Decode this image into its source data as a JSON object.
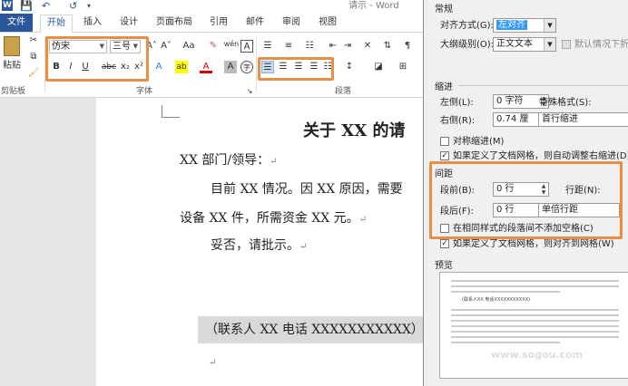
{
  "titlebar": {
    "quick_access": [
      "W",
      "💾",
      "↶",
      "↺"
    ],
    "title": "请示 - Word"
  },
  "tabs": [
    "文件",
    "开始",
    "插入",
    "设计",
    "页面布局",
    "引用",
    "邮件",
    "审阅",
    "视图"
  ],
  "ribbon": {
    "paste_label": "粘贴",
    "clipboard_label": "剪贴板",
    "font": {
      "name": "仿宋",
      "size": "三号",
      "label": "字体",
      "bold": "B",
      "italic": "I",
      "underline": "U",
      "strike": "abc",
      "sub": "x₂",
      "sup": "x²",
      "grow": "A˄",
      "shrink": "A˅",
      "case": "Aa",
      "clear": "✎",
      "pinyin": "wén",
      "border": "A",
      "effects": "A",
      "highlight": "ab",
      "color": "A",
      "shade": "A",
      "circle": "字"
    },
    "paragraph_label": "段落"
  },
  "document": {
    "title": "关于 XX 的请",
    "lines": [
      "XX 部门/领导：",
      "目前 XX 情况。因 XX 原因，需要",
      "设备 XX 件，所需资金 XX 元。",
      "妥否，请批示。"
    ],
    "contact": "（联系人 XX  电话 XXXXXXXXXXX）",
    "para_mark": "↵"
  },
  "dialog": {
    "general": "常规",
    "align_label": "对齐方式(G):",
    "align_value": "左对齐",
    "outline_label": "大纲级别(O):",
    "outline_value": "正文文本",
    "collapse_label": "默认情况下折叠",
    "indent": "缩进",
    "left_label": "左侧(L):",
    "left_value": "0 字符",
    "special_label": "特殊格式(S):",
    "right_label": "右侧(R):",
    "right_value": "0.74 厘",
    "special_value": "首行缩进",
    "mirror_label": "对称缩进(M)",
    "auto_right_label": "如果定义了文档网格，则自动调整右缩进(D)",
    "spacing": "间距",
    "before_label": "段前(B):",
    "before_value": "0 行",
    "after_label": "段后(F):",
    "after_value": "0 行",
    "line_label": "行距(N):",
    "line_value": "单倍行距",
    "no_space_label": "在相同样式的段落间不添加空格(C)",
    "snap_grid_label": "如果定义了文档网格，则对齐到网格(W)",
    "preview": "预览",
    "preview_sample": "(联系人XX 电话XXXXXXXXXXX)",
    "watermark": "www.sogou.com"
  },
  "colors": {
    "word_blue": "#2b579a",
    "highlight_orange": "#e98f45",
    "dialog_select": "#3399ff"
  }
}
